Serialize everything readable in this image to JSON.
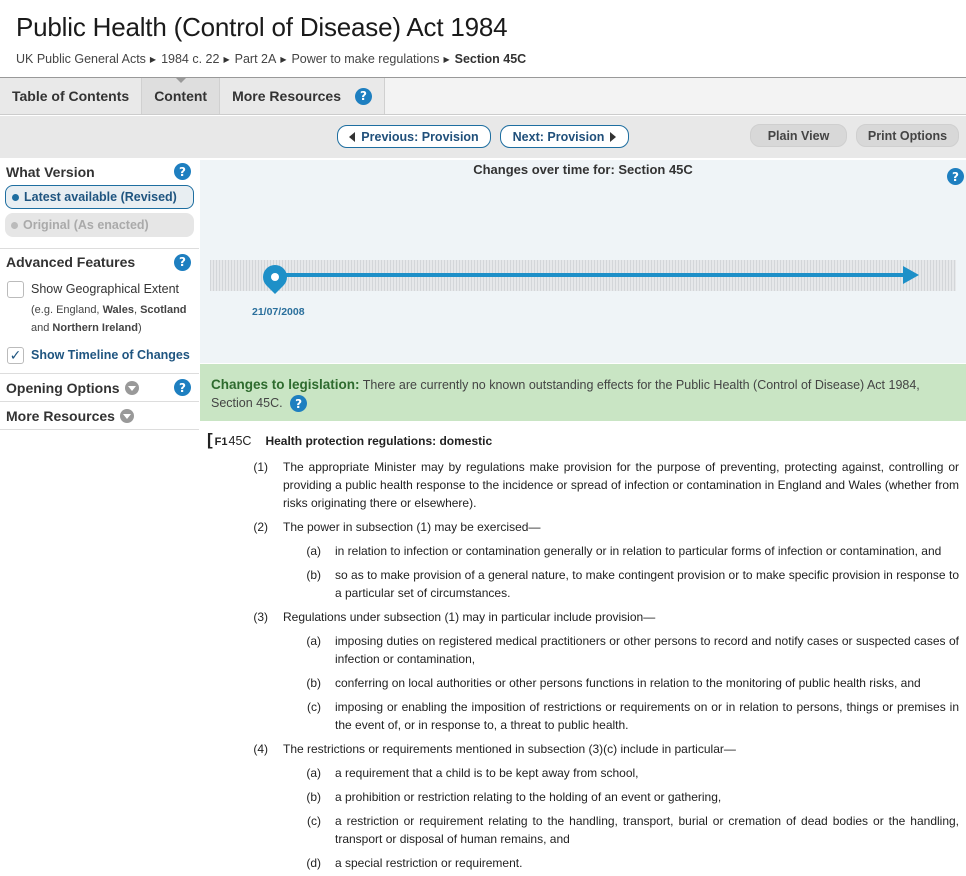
{
  "header": {
    "title": "Public Health (Control of Disease) Act 1984",
    "breadcrumb": [
      "UK Public General Acts",
      "1984 c. 22",
      "Part 2A",
      "Power to make regulations",
      "Section 45C"
    ]
  },
  "tabs": {
    "toc": "Table of Contents",
    "content": "Content",
    "more": "More Resources",
    "help": "?"
  },
  "toolbar": {
    "prev": "Previous: Provision",
    "next": "Next: Provision",
    "plain": "Plain View",
    "print": "Print Options"
  },
  "sidebar": {
    "what_version": "What Version",
    "latest": "Latest available (Revised)",
    "original": "Original (As enacted)",
    "advanced": "Advanced Features",
    "geo": "Show Geographical Extent",
    "geo_note_pre": "(e.g. England, ",
    "geo_wales": "Wales",
    "geo_sep": ", ",
    "geo_scotland": "Scotland",
    "geo_and": "and ",
    "geo_ni": "Northern Ireland",
    "geo_close": ")",
    "timeline": "Show Timeline of Changes",
    "opening": "Opening Options",
    "more_resources": "More Resources",
    "check_mark": "✓"
  },
  "timeline": {
    "title": "Changes over time for: Section 45C",
    "date": "21/07/2008"
  },
  "changes": {
    "label": "Changes to legislation:",
    "text": " There are currently no known outstanding effects for the Public Health (Control of Disease) Act 1984, Section 45C."
  },
  "section": {
    "bracket": "[",
    "ref": "F1",
    "num": "45C",
    "heading": "Health protection regulations: domestic",
    "paras": [
      {
        "num": "(1)",
        "text": "The appropriate Minister may by regulations make provision for the purpose of preventing, protecting against, controlling or providing a public health response to the incidence or spread of infection or contamination in England and Wales (whether from risks originating there or elsewhere)."
      },
      {
        "num": "(2)",
        "text": "The power in subsection (1) may be exercised—"
      },
      {
        "num": "(a)",
        "text": "in relation to infection or contamination generally or in relation to particular forms of infection or contamination, and"
      },
      {
        "num": "(b)",
        "text": "so as to make provision of a general nature, to make contingent provision or to make specific provision in response to a particular set of circumstances."
      },
      {
        "num": "(3)",
        "text": "Regulations under subsection (1) may in particular include provision—"
      },
      {
        "num": "(a)",
        "text": "imposing duties on registered medical practitioners or other persons to record and notify cases or suspected cases of infection or contamination,"
      },
      {
        "num": "(b)",
        "text": "conferring on local authorities or other persons functions in relation to the monitoring of public health risks, and"
      },
      {
        "num": "(c)",
        "text": "imposing or enabling the imposition of restrictions or requirements on or in relation to persons, things or premises in the event of, or in response to, a threat to public health."
      },
      {
        "num": "(4)",
        "text": "The restrictions or requirements mentioned in subsection (3)(c) include in particular—"
      },
      {
        "num": "(a)",
        "text": "a requirement that a child is to be kept away from school,"
      },
      {
        "num": "(b)",
        "text": "a prohibition or restriction relating to the holding of an event or gathering,"
      },
      {
        "num": "(c)",
        "text": "a restriction or requirement relating to the handling, transport, burial or cremation of dead bodies or the handling, transport or disposal of human remains, and"
      },
      {
        "num": "(d)",
        "text": "a special restriction or requirement."
      }
    ]
  }
}
